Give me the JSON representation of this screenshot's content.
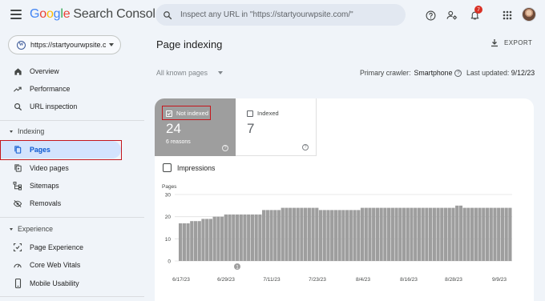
{
  "header": {
    "logo_google": [
      "G",
      "o",
      "o",
      "g",
      "l",
      "e"
    ],
    "logo_colors": [
      "#4285f4",
      "#ea4335",
      "#fbbc05",
      "#4285f4",
      "#34a853",
      "#ea4335"
    ],
    "logo_product": "Search Console",
    "search_placeholder": "Inspect any URL in \"https://startyourwpsite.com/\"",
    "notification_count": "7",
    "icons": [
      "menu-icon",
      "search-icon",
      "help-icon",
      "manage-users-icon",
      "notifications-icon",
      "apps-icon",
      "avatar"
    ]
  },
  "property": {
    "url": "https://startyourwpsite.com/",
    "icon": "wordpress-icon"
  },
  "sidebar": {
    "items": [
      {
        "label": "Overview",
        "icon": "home-icon"
      },
      {
        "label": "Performance",
        "icon": "trending-icon"
      },
      {
        "label": "URL inspection",
        "icon": "search-icon"
      }
    ],
    "indexing": {
      "heading": "Indexing",
      "items": [
        {
          "label": "Pages",
          "icon": "pages-icon",
          "active": true
        },
        {
          "label": "Video pages",
          "icon": "video-pages-icon"
        },
        {
          "label": "Sitemaps",
          "icon": "sitemaps-icon"
        },
        {
          "label": "Removals",
          "icon": "removals-icon"
        }
      ]
    },
    "experience": {
      "heading": "Experience",
      "items": [
        {
          "label": "Page Experience",
          "icon": "page-experience-icon"
        },
        {
          "label": "Core Web Vitals",
          "icon": "speed-icon"
        },
        {
          "label": "Mobile Usability",
          "icon": "phone-icon"
        }
      ]
    }
  },
  "main": {
    "title": "Page indexing",
    "export_label": "EXPORT",
    "filter_label": "All known pages",
    "crawler_label": "Primary crawler:",
    "crawler_value": "Smartphone",
    "updated_label": "Last updated:",
    "updated_value": "9/12/23",
    "tiles": {
      "not_indexed": {
        "label": "Not indexed",
        "count": "24",
        "sub": "6 reasons",
        "selected": true,
        "color": "#9e9e9e"
      },
      "indexed": {
        "label": "Indexed",
        "count": "7",
        "selected": false
      }
    },
    "impressions_label": "Impressions",
    "annotation_marker": "1"
  },
  "chart_data": {
    "type": "bar",
    "ylabel": "Pages",
    "ylim": [
      0,
      30
    ],
    "yticks": [
      0,
      10,
      20,
      30
    ],
    "x_tick_labels": [
      "6/17/23",
      "6/29/23",
      "7/11/23",
      "7/23/23",
      "8/4/23",
      "8/16/23",
      "8/28/23",
      "9/9/23"
    ],
    "bar_color": "#9e9e9e",
    "grid": true,
    "values": [
      17,
      17,
      17,
      18,
      18,
      18,
      19,
      19,
      19,
      20,
      20,
      20,
      21,
      21,
      21,
      21,
      21,
      21,
      21,
      21,
      21,
      21,
      23,
      23,
      23,
      23,
      23,
      24,
      24,
      24,
      24,
      24,
      24,
      24,
      24,
      24,
      24,
      23,
      23,
      23,
      23,
      23,
      23,
      23,
      23,
      23,
      23,
      23,
      24,
      24,
      24,
      24,
      24,
      24,
      24,
      24,
      24,
      24,
      24,
      24,
      24,
      24,
      24,
      24,
      24,
      24,
      24,
      24,
      24,
      24,
      24,
      24,
      24,
      25,
      25,
      24,
      24,
      24,
      24,
      24,
      24,
      24,
      24,
      24,
      24,
      24,
      24,
      24
    ]
  }
}
